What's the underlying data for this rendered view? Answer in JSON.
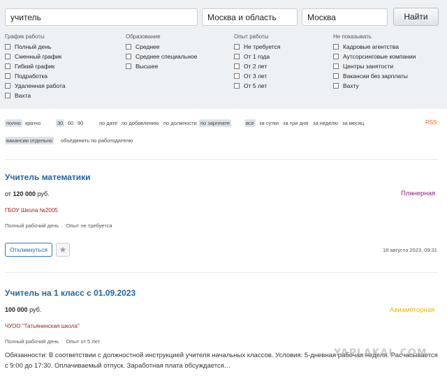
{
  "search": {
    "query": "учитель",
    "region": "Москва и область",
    "city": "Москва",
    "submit_label": "Найти"
  },
  "filters": [
    {
      "title": "График работы",
      "items": [
        "Полный день",
        "Сменный график",
        "Гибкий график",
        "Подработка",
        "Удаленная работа",
        "Вахта"
      ]
    },
    {
      "title": "Образование",
      "items": [
        "Среднее",
        "Среднее специальное",
        "Высшее"
      ]
    },
    {
      "title": "Опыт работы",
      "items": [
        "Не требуется",
        "От 1 года",
        "От 2 лет",
        "От 3 лет",
        "От 5 лет"
      ]
    },
    {
      "title": "Не показывать",
      "items": [
        "Кадровые агентства",
        "Аутсорсинговые компании",
        "Центры занятости",
        "Вакансии без зарплаты",
        "Вахту"
      ]
    }
  ],
  "view_options": {
    "detail": [
      "полно",
      "кратко"
    ],
    "per_page": [
      "30",
      "60",
      "90"
    ],
    "sort": [
      "по дате",
      "по добавлению",
      "по должности",
      "по зарплате"
    ],
    "period": [
      "все",
      "за сутки",
      "за три дня",
      "за неделю",
      "за месяц"
    ],
    "rss": "RSS",
    "grouping": [
      "вакансии отдельно",
      "объединить по работодателю"
    ]
  },
  "vacancies": [
    {
      "title": "Учитель математики",
      "salary_prefix": "от",
      "salary_amount": "120 000",
      "salary_currency": "руб.",
      "metro": "Планерная",
      "metro_color": "#8a1f7a",
      "company": "ГБОУ Школа №2005",
      "schedule": "Полный рабочий день",
      "experience": "Опыт не требуется",
      "respond_label": "Откликнуться",
      "date": "18 августа 2023, 09:31"
    },
    {
      "title": "Учитель на 1 класс с 01.09.2023",
      "salary_amount": "100 000",
      "salary_currency": "руб.",
      "metro": "Авиамоторная",
      "metro_color": "#e6b800",
      "company": "ЧУОО \"Татьянинская школа\"",
      "schedule": "Полный рабочий день",
      "experience": "Опыт от 5 лет",
      "description": "Обязанности: В соответствии с должностной инструкцией учителя начальных классов. Условия: 5-дневная рабочая неделя. Расчасывается с 9:00 до 17:30. Оплачиваемый отпуск. Заработная плата обсуждается…"
    }
  ],
  "watermark": "YAPLAKAL.COM",
  "colors": {
    "link": "#2163a6",
    "company": "#9b1a1a",
    "rss": "#e0651a"
  }
}
